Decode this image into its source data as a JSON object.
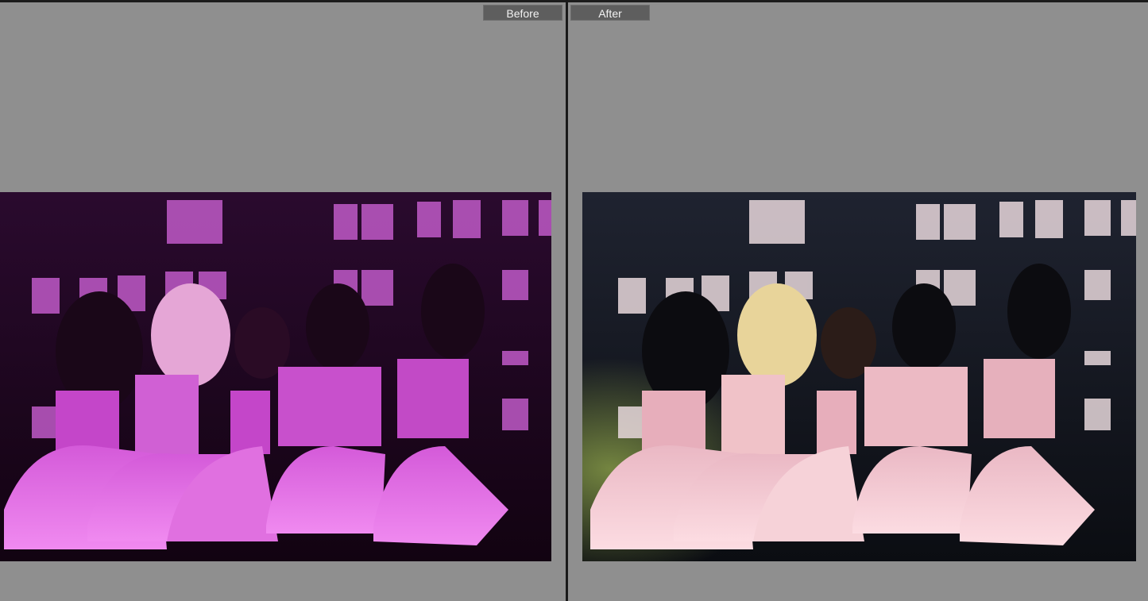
{
  "compare": {
    "before_label": "Before",
    "after_label": "After"
  },
  "colors": {
    "background": "#8f8f8f",
    "label_bg": "#5e5e5e",
    "divider": "#1a1a1a",
    "before_tint": "#c23ad1",
    "after_tint": "#f4c6d0"
  },
  "photo": {
    "subject": "stage-performance-group-photo"
  }
}
